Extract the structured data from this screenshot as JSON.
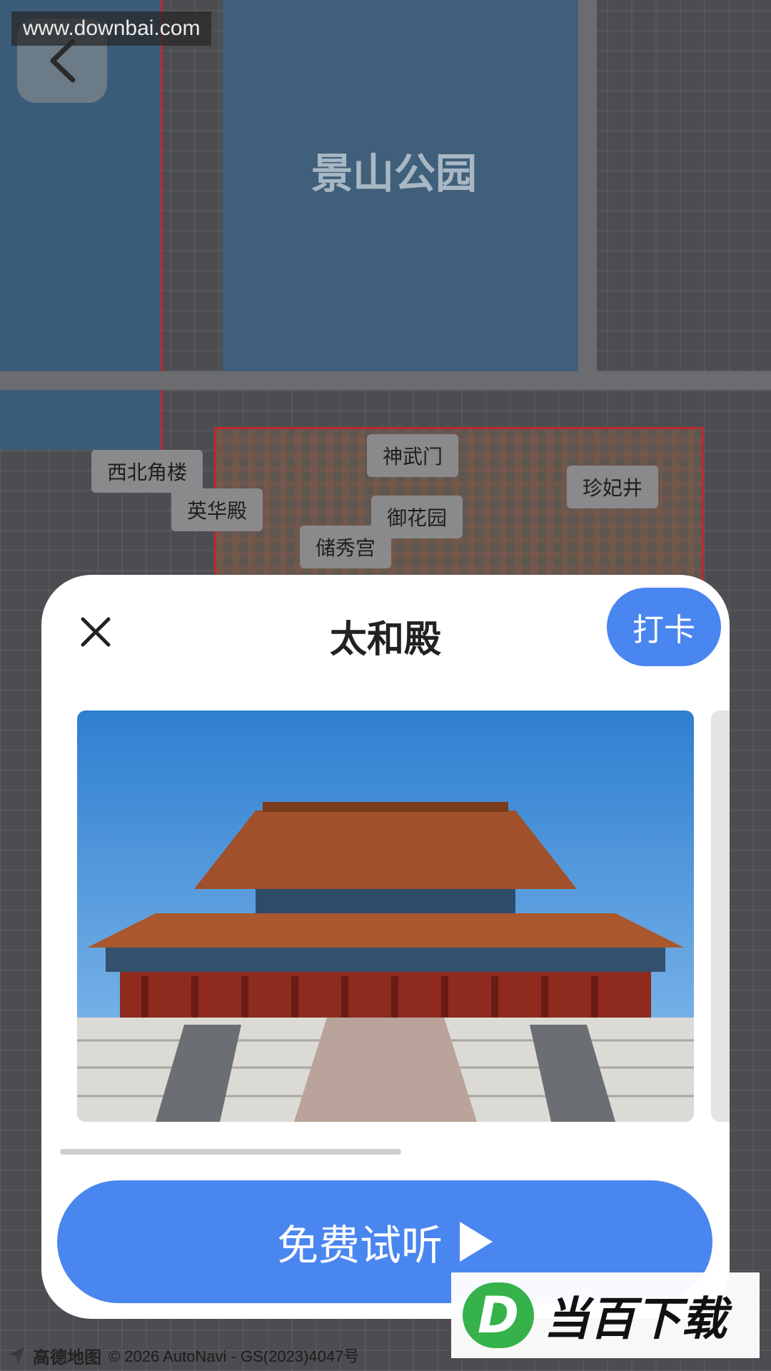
{
  "watermark_top": "www.downbai.com",
  "map": {
    "park_label": "景山公园",
    "tags": [
      {
        "name": "tag-xibeijiaolou",
        "label": "西北角楼"
      },
      {
        "name": "tag-yinghuadian",
        "label": "英华殿"
      },
      {
        "name": "tag-shenwumen",
        "label": "神武门"
      },
      {
        "name": "tag-yuhuayuan",
        "label": "御花园"
      },
      {
        "name": "tag-chuxiugong",
        "label": "储秀宫"
      },
      {
        "name": "tag-zhenfeijing",
        "label": "珍妃井"
      }
    ],
    "credit_logo": "高德地图",
    "credit_text": "© 2026 AutoNavi - GS(2023)4047号"
  },
  "sheet": {
    "title": "太和殿",
    "checkin_label": "打卡",
    "listen_label": "免费试听"
  },
  "brand_watermark": {
    "mark": "D",
    "text": "当百下载"
  },
  "colors": {
    "accent": "#4a86ef",
    "border_red": "#c0282c"
  }
}
